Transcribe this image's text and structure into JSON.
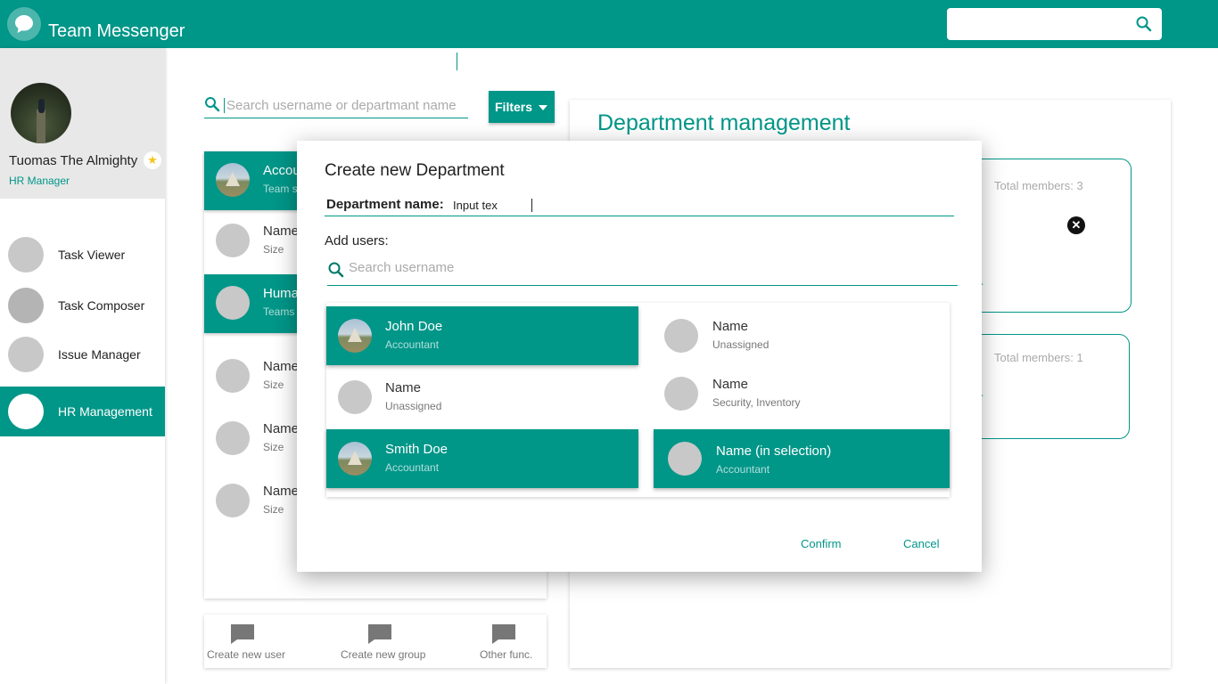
{
  "app": {
    "title": "Team Messenger",
    "logo_icon": "chat-bubble-icon",
    "search_value": ""
  },
  "profile": {
    "name": "Tuomas The Almighty",
    "role": "HR Manager",
    "badge_icon": "star-icon"
  },
  "nav": [
    {
      "label": "Task Viewer",
      "active": false
    },
    {
      "label": "Task Composer",
      "active": false
    },
    {
      "label": "Issue Manager",
      "active": false
    },
    {
      "label": "HR Management",
      "active": true
    }
  ],
  "user_search": {
    "placeholder": "Search username or departmant name"
  },
  "filters": {
    "label": "Filters"
  },
  "list": [
    {
      "title": "Accou",
      "sub": "Team s",
      "selected": true,
      "photo": true
    },
    {
      "title": "Name",
      "sub": "Size",
      "selected": false,
      "photo": false
    },
    {
      "title": "Huma",
      "sub": "Teams",
      "selected": true,
      "photo": false
    },
    {
      "title": "Name",
      "sub": "Size",
      "selected": false,
      "photo": false
    },
    {
      "title": "Name",
      "sub": "Size",
      "selected": false,
      "photo": false
    },
    {
      "title": "Name",
      "sub": "Size",
      "selected": false,
      "photo": false
    }
  ],
  "toolbar": {
    "create_user": "Create new user",
    "create_group": "Create new group",
    "other": "Other func."
  },
  "dept_panel": {
    "title": "Department management",
    "cards": [
      {
        "members": "Total members: 3",
        "link": "er"
      },
      {
        "members": "Total members: 1",
        "link": "er"
      }
    ]
  },
  "modal": {
    "title": "Create new Department",
    "dept_name_label": "Department name:",
    "dept_name_value": "Input tex",
    "add_users_label": "Add users:",
    "search_placeholder": "Search username",
    "users": [
      {
        "name": "John Doe",
        "role": "Accountant",
        "selected": true
      },
      {
        "name": "Name",
        "role": "Unassigned",
        "selected": false
      },
      {
        "name": "Name",
        "role": "Unassigned",
        "selected": false
      },
      {
        "name": "Name",
        "role": "Security, Inventory",
        "selected": false
      },
      {
        "name": "Smith Doe",
        "role": "Accountant",
        "selected": true
      },
      {
        "name": "Name (in selection)",
        "role": "Accountant",
        "selected": true
      }
    ],
    "confirm": "Confirm",
    "cancel": "Cancel"
  },
  "colors": {
    "primary": "#009688",
    "placeholder": "#c8c8c8"
  }
}
